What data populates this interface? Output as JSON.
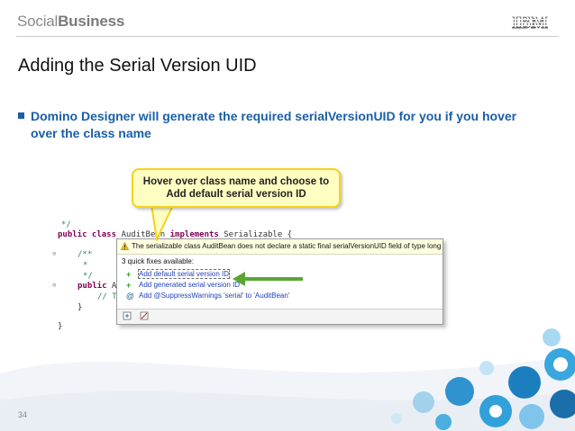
{
  "header": {
    "brand_light": "Social",
    "brand_bold": "Business",
    "logo_text": "IBM"
  },
  "slide": {
    "title": "Adding the Serial Version UID",
    "bullet": "Domino Designer will generate the required serialVersionUID for you if you hover over the class name",
    "callout_line1": "Hover over class name and choose to",
    "callout_line2": "Add default serial version ID",
    "page_number": "34"
  },
  "code": {
    "line1": "*/",
    "line2_kw": "public class",
    "line2_rest": " AuditBean ",
    "line2_kw2": "implements",
    "line2_tail": " Serializable {",
    "line3": "/**",
    "line4": "*",
    "line5": "*/",
    "line6_kw": "public",
    "line6_rest": " A",
    "line7": "// T",
    "line8": "}",
    "line9": "}"
  },
  "popup": {
    "warning": "The serializable class AuditBean does not declare a static final serialVersionUID field of type long",
    "count": "3 quick fixes available:",
    "fixes": [
      {
        "label": "Add default serial version ID",
        "icon": "plus"
      },
      {
        "label": "Add generated serial version ID",
        "icon": "plus"
      },
      {
        "label": "Add @SuppressWarnings 'serial' to 'AuditBean'",
        "icon": "at"
      }
    ],
    "plus_glyph": "+",
    "at_glyph": "@"
  },
  "colors": {
    "accent_blue": "#1a5fa8",
    "callout_fill": "#ffffc2",
    "callout_border": "#f5d21b",
    "arrow_green": "#5aa632",
    "link_blue": "#2142b8"
  }
}
